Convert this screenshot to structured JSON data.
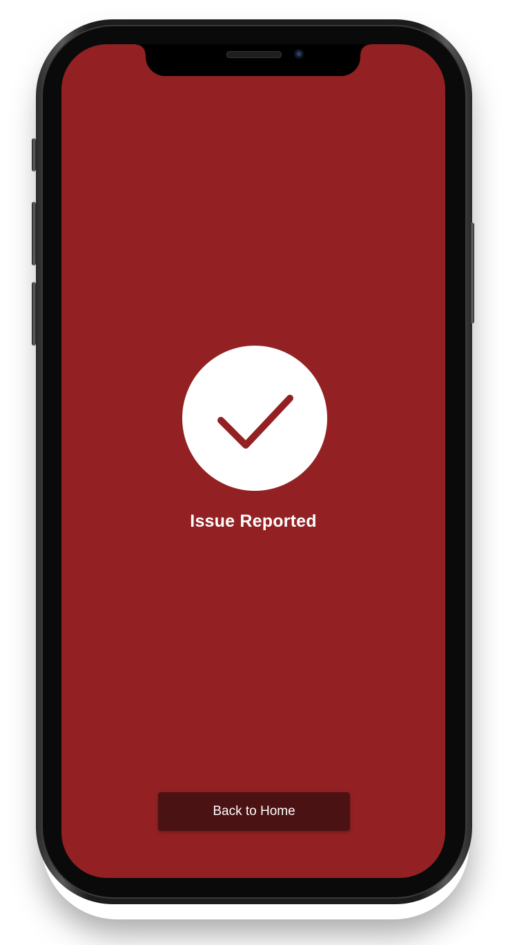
{
  "screen": {
    "background_color": "#932123",
    "status_icon": "checkmark-circle-icon",
    "title": "Issue Reported",
    "back_button_label": "Back to Home",
    "button_color": "#4b1213"
  }
}
